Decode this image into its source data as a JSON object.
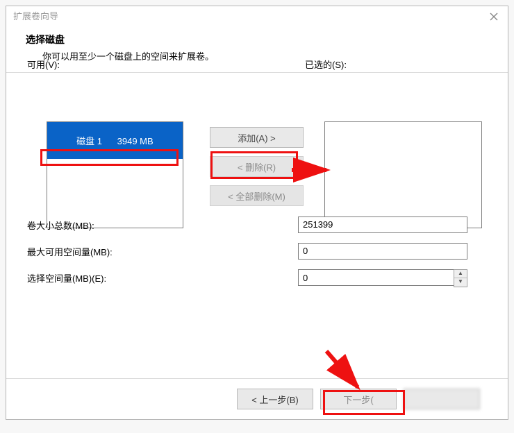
{
  "window": {
    "title": "扩展卷向导"
  },
  "header": {
    "title": "选择磁盘",
    "subtitle": "你可以用至少一个磁盘上的空间来扩展卷。"
  },
  "labels": {
    "available": "可用(V):",
    "selected": "已选的(S):",
    "total_size": "卷大小总数(MB):",
    "max_space": "最大可用空间量(MB):",
    "choose_space": "选择空间量(MB)(E):"
  },
  "available_disks": [
    {
      "name": "磁盘 1",
      "size": "3949 MB"
    }
  ],
  "buttons": {
    "add": "添加(A) >",
    "remove": "< 删除(R)",
    "remove_all": "< 全部删除(M)",
    "back": "< 上一步(B)",
    "next": "下一步("
  },
  "values": {
    "total_size": "251399",
    "max_space": "0",
    "choose_space": "0"
  }
}
